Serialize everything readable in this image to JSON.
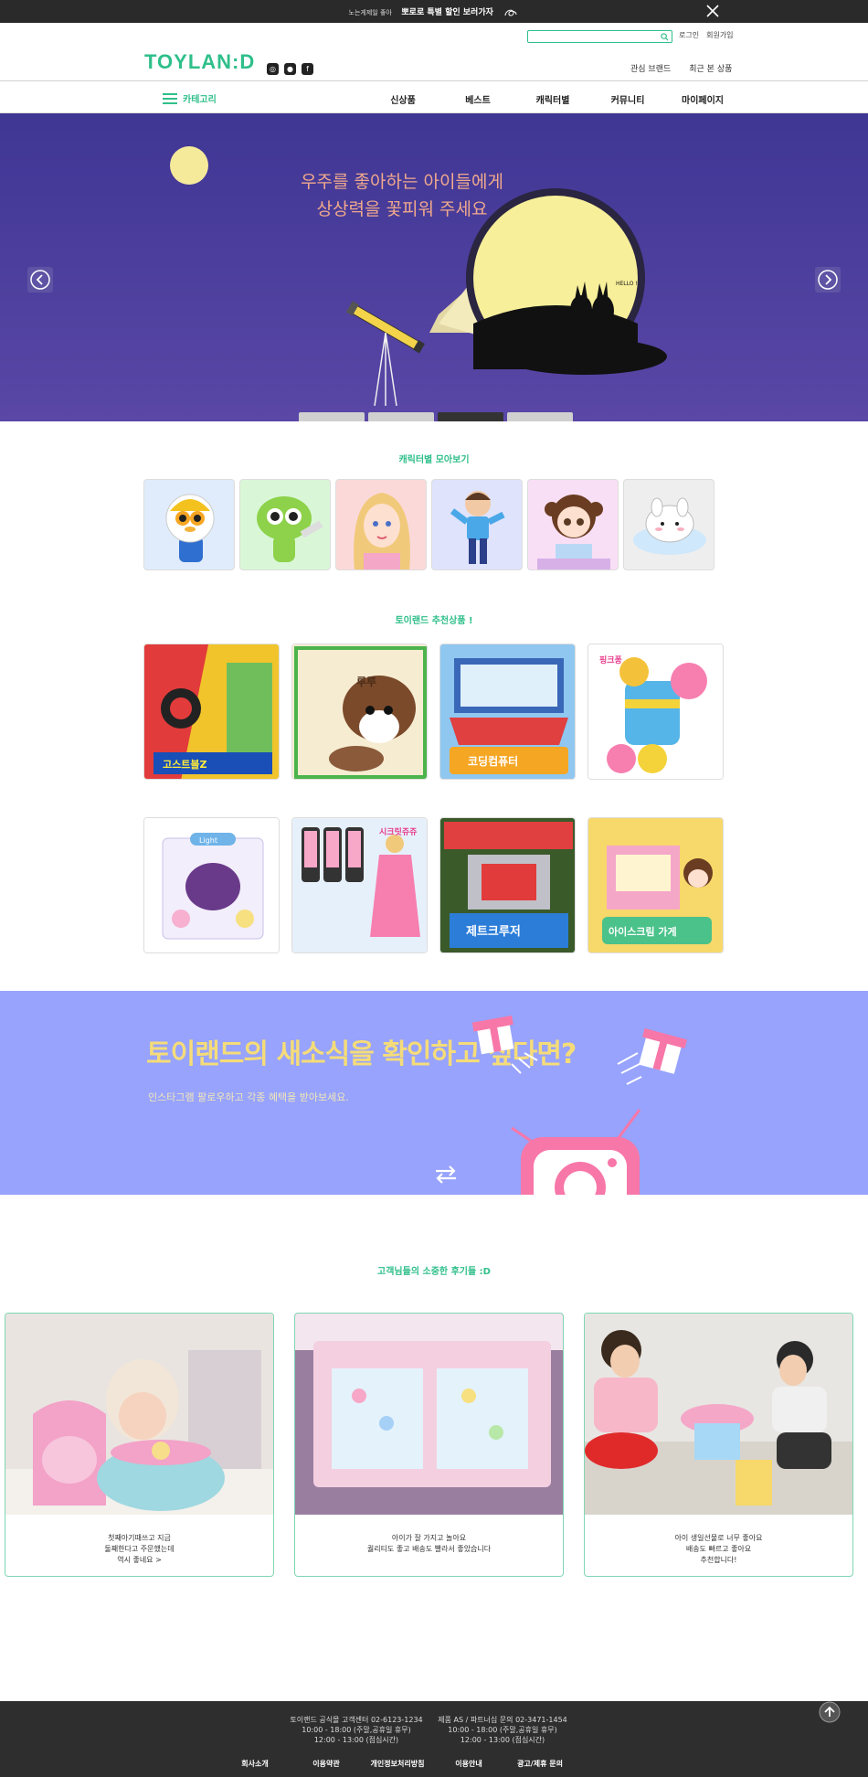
{
  "topbar": {
    "promo_prefix": "노는게제일 좋아",
    "promo_main": "뽀로로 특별 할인 보러가자"
  },
  "header": {
    "logo": "TOYLAN:D",
    "search_placeholder": "",
    "login": "로그인",
    "join": "회원가입",
    "fav_brand": "관심 브랜드",
    "recent": "최근 본 상품"
  },
  "nav": {
    "category": "카테고리",
    "items": [
      "신상품",
      "베스트",
      "캐릭터별",
      "커뮤니티",
      "마이페이지"
    ]
  },
  "hero": {
    "line1": "우주를 좋아하는 아이들에게",
    "line2": "상상력을 꽃피워 주세요",
    "hello": "HELLO !",
    "active_slide": 3,
    "slide_count": 4
  },
  "characters": {
    "title": "캐릭터별 모아보기",
    "items": [
      {
        "name": "pororo",
        "bg": "#e0ecfb"
      },
      {
        "name": "dino",
        "bg": "#d9f7d7"
      },
      {
        "name": "secret-jouju",
        "bg": "#fbd9d9"
      },
      {
        "name": "boy",
        "bg": "#dfe3fb"
      },
      {
        "name": "kongsuni",
        "bg": "#f9dff5"
      },
      {
        "name": "molang",
        "bg": "#eeeeee"
      }
    ]
  },
  "recommend": {
    "title": "토이랜드 추천상품 !",
    "row1": [
      {
        "name": "ghost-ball-z",
        "bg": "#f1c42b",
        "label": "고스트볼Z"
      },
      {
        "name": "puppy-toy",
        "bg": "#f6ecd2",
        "label": "루루"
      },
      {
        "name": "coding-computer",
        "bg": "#8fc7f0",
        "label": "코딩컴퓨터"
      },
      {
        "name": "pinkfong-pirate",
        "bg": "#ffffff",
        "label": "핑크퐁"
      }
    ],
    "row2": [
      {
        "name": "light-bag",
        "bg": "#f2eefb",
        "label": "Light"
      },
      {
        "name": "secret-jouju-phone",
        "bg": "#e6f0fb",
        "label": "시크릿쥬쥬"
      },
      {
        "name": "jet-cruiser",
        "bg": "#5c8a3a",
        "label": "제트크루저"
      },
      {
        "name": "ice-cream-shop",
        "bg": "#f7d86a",
        "label": "아이스크림 가게"
      }
    ]
  },
  "insta": {
    "headline": "토이랜드의 새소식을 확인하고 싶다면?",
    "sub": "인스타그램 팔로우하고 각종 혜택을 받아보세요."
  },
  "reviews": {
    "title": "고객님들의 소중한 후기들 :D",
    "items": [
      {
        "text": "첫째아기때쓰고 지금\n둘째한다고 주문했는데\n역시 좋네요 >"
      },
      {
        "text": "아이가 잘 가지고 놀아요\n퀄리티도 좋고 배송도 빨라서 좋았습니다"
      },
      {
        "text": "아이 생일선물로 너무 좋아요\n배송도 빠르고 좋아요\n추천합니다!"
      }
    ]
  },
  "footer": {
    "cs": "토이랜드 공식몰 고객센터 02-6123-1234\n10:00 - 18:00 (주말,공휴일 휴무)\n12:00 - 13:00 (점심시간)",
    "as": "제품 AS / 파트너십 문의 02-3471-1454\n10:00 - 18:00 (주말,공휴일 휴무)\n12:00 - 13:00 (점심시간)",
    "links": [
      "회사소개",
      "이용약관",
      "개인정보처리방침",
      "이용안내",
      "광고/제휴 문의"
    ]
  }
}
